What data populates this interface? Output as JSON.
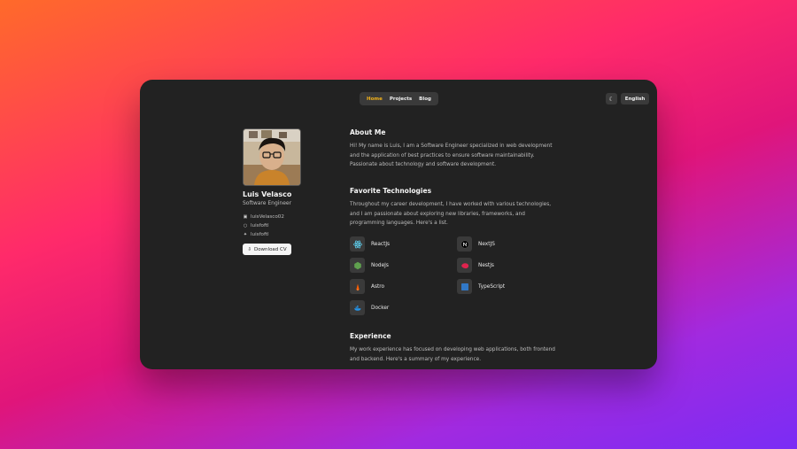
{
  "nav": {
    "home": "Home",
    "projects": "Projects",
    "blog": "Blog"
  },
  "header": {
    "language": "English",
    "theme_icon": "moon-icon"
  },
  "profile": {
    "name": "Luis Velasco",
    "role": "Software Engineer",
    "linkedin": "luisVelasco02",
    "github": "luisfoftl",
    "twitter": "luisfoftl",
    "download_cv": "Download CV"
  },
  "about": {
    "title": "About Me",
    "text": "Hi! My name is Luis, I am a Software Engineer specialized in web development and the application of best practices to ensure software maintainability. Passionate about technology and software development."
  },
  "technologies": {
    "title": "Favorite Technologies",
    "text": "Throughout my career development, I have worked with various technologies, and I am passionate about exploring new libraries, frameworks, and programming languages. Here's a list.",
    "items": [
      {
        "label": "ReactJs",
        "icon": "react-icon",
        "color": "#61dafb"
      },
      {
        "label": "NextJS",
        "icon": "nextjs-icon",
        "color": "#000000"
      },
      {
        "label": "NodeJs",
        "icon": "nodejs-icon",
        "color": "#5fa04e"
      },
      {
        "label": "NestJs",
        "icon": "nestjs-icon",
        "color": "#e0234e"
      },
      {
        "label": "Astro",
        "icon": "astro-icon",
        "color": "#ff5d01"
      },
      {
        "label": "TypeScript",
        "icon": "typescript-icon",
        "color": "#3178c6"
      },
      {
        "label": "Docker",
        "icon": "docker-icon",
        "color": "#2496ed"
      }
    ]
  },
  "experience": {
    "title": "Experience",
    "text": "My work experience has focused on developing web applications, both frontend and backend. Here's a summary of my experience."
  }
}
